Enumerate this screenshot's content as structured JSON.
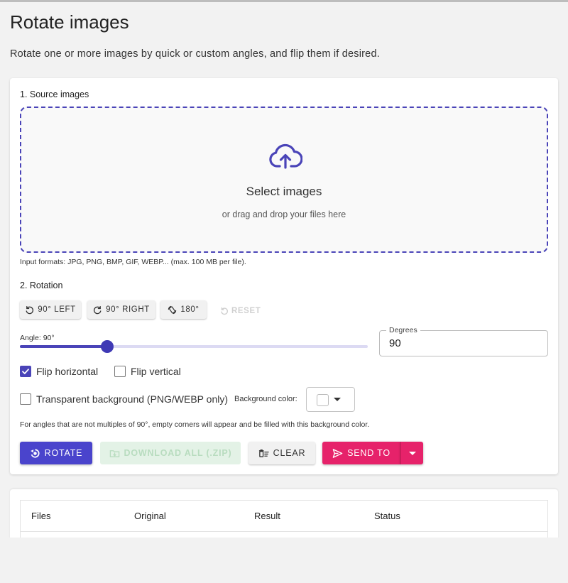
{
  "page": {
    "title": "Rotate images",
    "description": "Rotate one or more images by quick or custom angles, and flip them if desired."
  },
  "source": {
    "section_label": "1. Source images",
    "dropzone_title": "Select images",
    "dropzone_subtitle": "or drag and drop your files here",
    "formats_note": "Input formats: JPG, PNG, BMP, GIF, WEBP... (max. 100 MB per file)."
  },
  "rotation": {
    "section_label": "2. Rotation",
    "quick_buttons": {
      "left_90": "90° LEFT",
      "right_90": "90° RIGHT",
      "rotate_180": "180°",
      "reset": "RESET"
    },
    "angle_label": "Angle: 90°",
    "slider_fraction": 0.25,
    "degrees_label": "Degrees",
    "degrees_value": "90"
  },
  "options": {
    "flip_horizontal": {
      "label": "Flip horizontal",
      "checked": true
    },
    "flip_vertical": {
      "label": "Flip vertical",
      "checked": false
    },
    "transparent_background": {
      "label": "Transparent background (PNG/WEBP only)",
      "checked": false
    },
    "background_color_label": "Background color:",
    "background_color": "#ffffff",
    "corners_note": "For angles that are not multiples of 90°, empty corners will appear and be filled with this background color."
  },
  "actions": {
    "rotate": "ROTATE",
    "download_all": "DOWNLOAD ALL (.ZIP)",
    "clear": "CLEAR",
    "send_to": "SEND TO"
  },
  "results_table": {
    "columns": [
      "Files",
      "Original",
      "Result",
      "Status"
    ]
  },
  "colors": {
    "accent": "#4a44cc",
    "send_to": "#e6226a",
    "download_disabled_bg": "#e3f2e6"
  }
}
